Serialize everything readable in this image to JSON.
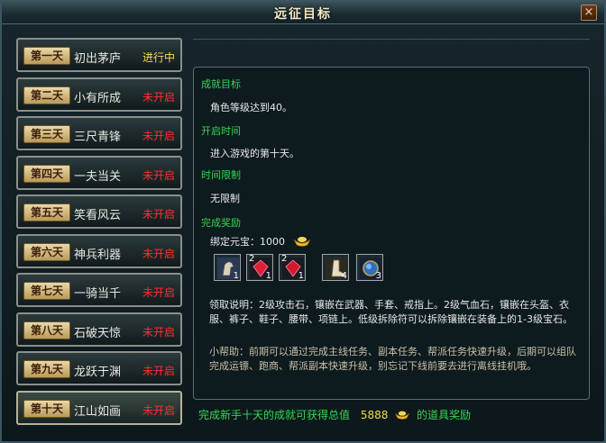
{
  "window": {
    "title": "远征目标",
    "close_label": "×"
  },
  "days": [
    {
      "tag": "第一天",
      "name": "初出茅庐",
      "status": "进行中",
      "state": "going"
    },
    {
      "tag": "第二天",
      "name": "小有所成",
      "status": "未开启",
      "state": "closed"
    },
    {
      "tag": "第三天",
      "name": "三尺青锋",
      "status": "未开启",
      "state": "closed"
    },
    {
      "tag": "第四天",
      "name": "一夫当关",
      "status": "未开启",
      "state": "closed"
    },
    {
      "tag": "第五天",
      "name": "笑看风云",
      "status": "未开启",
      "state": "closed"
    },
    {
      "tag": "第六天",
      "name": "神兵利器",
      "status": "未开启",
      "state": "closed"
    },
    {
      "tag": "第七天",
      "name": "一骑当千",
      "status": "未开启",
      "state": "closed"
    },
    {
      "tag": "第八天",
      "name": "石破天惊",
      "status": "未开启",
      "state": "closed"
    },
    {
      "tag": "第九天",
      "name": "龙跃于渊",
      "status": "未开启",
      "state": "closed"
    },
    {
      "tag": "第十天",
      "name": "江山如画",
      "status": "未开启",
      "state": "closed"
    }
  ],
  "detail": {
    "goal_header": "成就目标",
    "goal_text": "角色等级达到40。",
    "open_header": "开启时间",
    "open_text": "进入游戏的第十天。",
    "limit_header": "时间限制",
    "limit_text": "无限制",
    "reward_header": "完成奖励",
    "reward_text": "绑定元宝：1000",
    "items": [
      {
        "icon": "horse-mount-icon",
        "count_top": "",
        "count_bottom": "1"
      },
      {
        "icon": "red-gem-icon",
        "count_top": "2",
        "count_bottom": "1"
      },
      {
        "icon": "red-gem-icon",
        "count_top": "2",
        "count_bottom": "1"
      },
      {
        "icon": "boot-icon",
        "count_top": "",
        "count_bottom": "4"
      },
      {
        "icon": "blue-orb-icon",
        "count_top": "",
        "count_bottom": "3"
      }
    ],
    "desc_text": "领取说明：2级攻击石，镶嵌在武器、手套、戒指上。2级气血石，镶嵌在头盔、衣服、裤子、鞋子、腰带、项链上。低级拆除符可以拆除镶嵌在装备上的1-3级宝石。",
    "help_text": "小帮助：前期可以通过完成主线任务、副本任务、帮派任务快速升级，后期可以组队完成运镖、跑商、帮派副本快速升级，别忘记下线前要去进行离线挂机哦。"
  },
  "footer": {
    "prefix": "完成新手十天的成就可获得总值",
    "value": "5888",
    "suffix": "的道具奖励"
  },
  "colors": {
    "section": "#35d653",
    "going": "#f3dc4e",
    "closed": "#ff2e2e"
  }
}
